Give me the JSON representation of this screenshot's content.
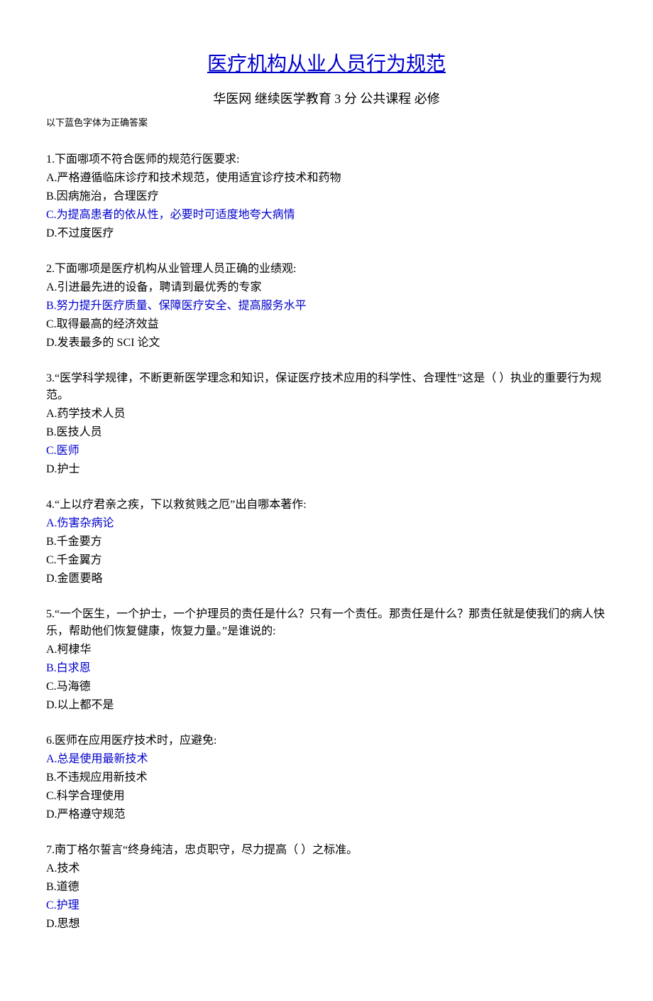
{
  "title": "医疗机构从业人员行为规范",
  "subtitle": "华医网  继续医学教育  3 分  公共课程  必修",
  "note": "以下蓝色字体为正确答案",
  "questions": [
    {
      "text": "1.下面哪项不符合医师的规范行医要求:",
      "options": [
        {
          "label": "A.严格遵循临床诊疗和技术规范，使用适宜诊疗技术和药物",
          "correct": false
        },
        {
          "label": "B.因病施治，合理医疗",
          "correct": false
        },
        {
          "label": "C.为提高患者的依从性，必要时可适度地夸大病情",
          "correct": true
        },
        {
          "label": "D.不过度医疗",
          "correct": false
        }
      ]
    },
    {
      "text": "2.下面哪项是医疗机构从业管理人员正确的业绩观:",
      "options": [
        {
          "label": "A.引进最先进的设备，聘请到最优秀的专家",
          "correct": false
        },
        {
          "label": "B.努力提升医疗质量、保障医疗安全、提高服务水平",
          "correct": true
        },
        {
          "label": "C.取得最高的经济效益",
          "correct": false
        },
        {
          "label": "D.发表最多的 SCI 论文",
          "correct": false
        }
      ]
    },
    {
      "text": "3.“医学科学规律，不断更新医学理念和知识，保证医疗技术应用的科学性、合理性”这是（  ）执业的重要行为规范。",
      "options": [
        {
          "label": "A.药学技术人员",
          "correct": false
        },
        {
          "label": "B.医技人员",
          "correct": false
        },
        {
          "label": "C.医师",
          "correct": true
        },
        {
          "label": "D.护士",
          "correct": false
        }
      ]
    },
    {
      "text": "4.“上以疗君亲之疾，下以救贫贱之厄”出自哪本著作:",
      "options": [
        {
          "label": "A.伤害杂病论",
          "correct": true
        },
        {
          "label": "B.千金要方",
          "correct": false
        },
        {
          "label": "C.千金翼方",
          "correct": false
        },
        {
          "label": "D.金匮要略",
          "correct": false
        }
      ]
    },
    {
      "text": "5.“一个医生，一个护士，一个护理员的责任是什么？只有一个责任。那责任是什么？那责任就是使我们的病人快乐，帮助他们恢复健康，恢复力量。”是谁说的:",
      "options": [
        {
          "label": "A.柯棣华",
          "correct": false
        },
        {
          "label": "B.白求恩",
          "correct": true
        },
        {
          "label": "C.马海德",
          "correct": false
        },
        {
          "label": "D.以上都不是",
          "correct": false
        }
      ]
    },
    {
      "text": "6.医师在应用医疗技术时，应避免:",
      "options": [
        {
          "label": "A.总是使用最新技术",
          "correct": true
        },
        {
          "label": "B.不违规应用新技术",
          "correct": false
        },
        {
          "label": "C.科学合理使用",
          "correct": false
        },
        {
          "label": "D.严格遵守规范",
          "correct": false
        }
      ]
    },
    {
      "text": "7.南丁格尔誓言“终身纯洁，忠贞职守，尽力提高（  ）之标准。",
      "options": [
        {
          "label": "A.技术",
          "correct": false
        },
        {
          "label": "B.道德",
          "correct": false
        },
        {
          "label": "C.护理",
          "correct": true
        },
        {
          "label": "D.思想",
          "correct": false
        }
      ]
    }
  ]
}
